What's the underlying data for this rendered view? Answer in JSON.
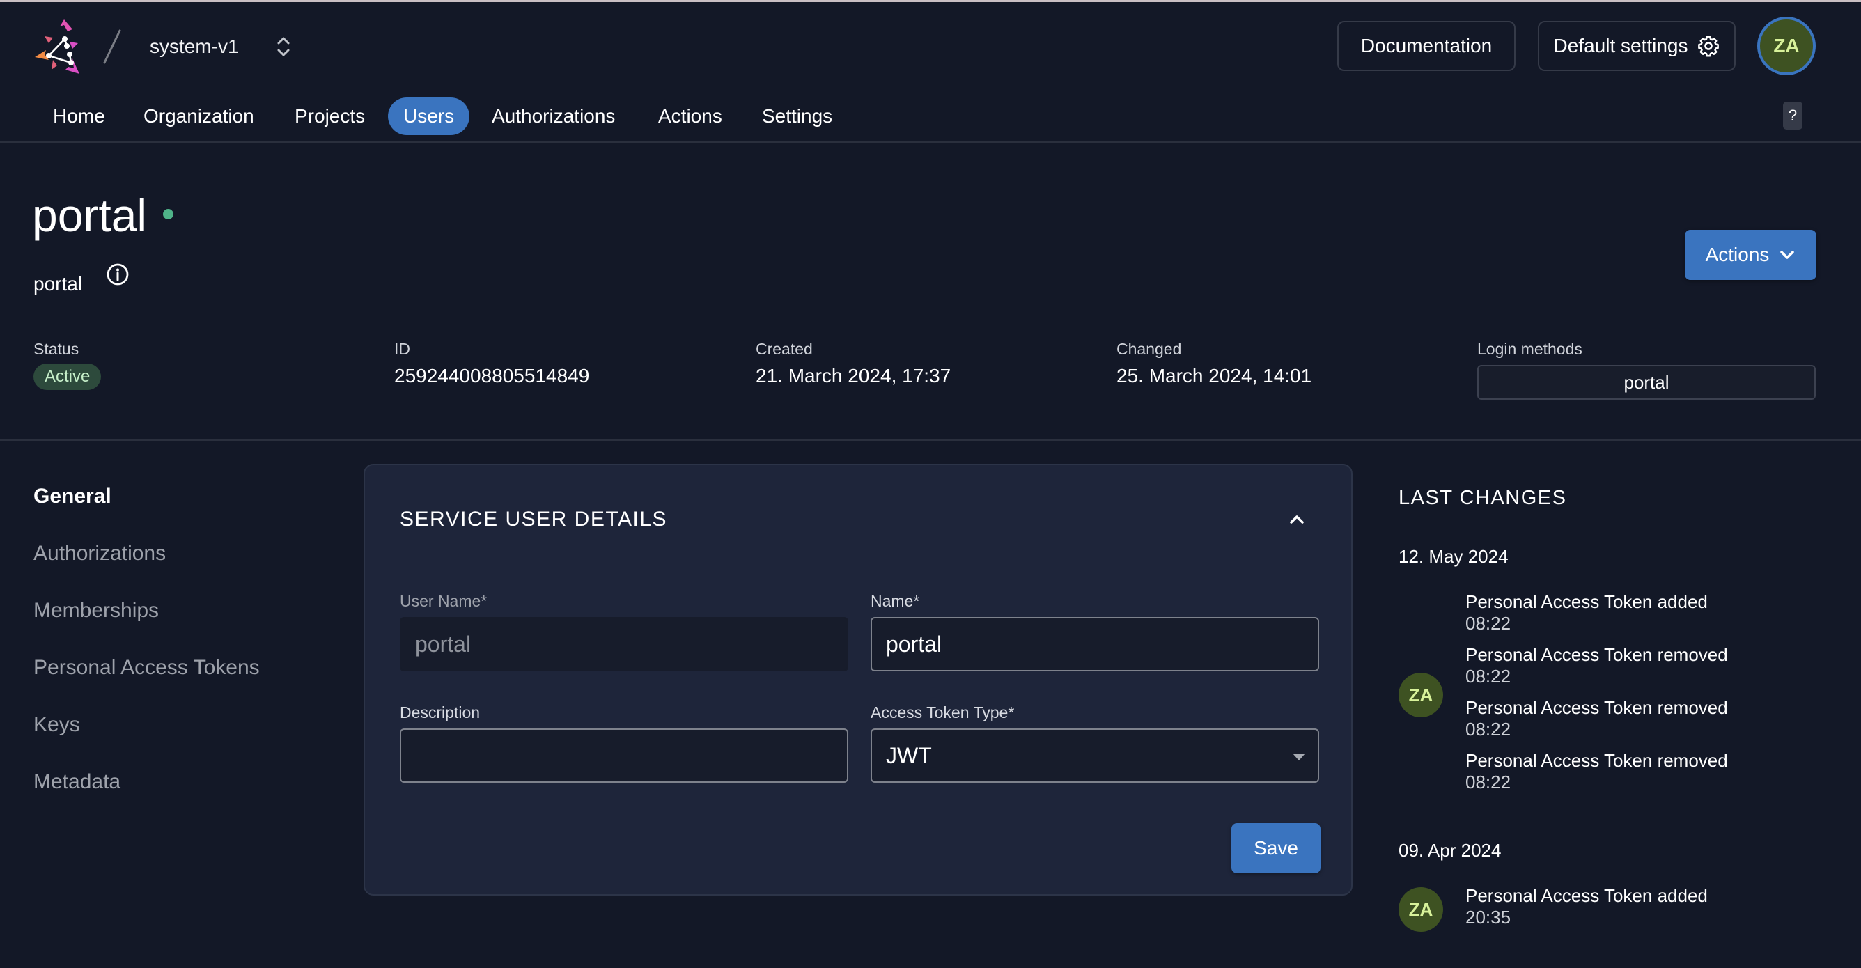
{
  "header": {
    "org_name": "system-v1",
    "documentation_label": "Documentation",
    "default_settings_label": "Default settings",
    "user_initials": "ZA",
    "help_label": "?"
  },
  "nav": {
    "tabs": [
      {
        "label": "Home",
        "active": false
      },
      {
        "label": "Organization",
        "active": false
      },
      {
        "label": "Projects",
        "active": false
      },
      {
        "label": "Users",
        "active": true
      },
      {
        "label": "Authorizations",
        "active": false
      },
      {
        "label": "Actions",
        "active": false
      },
      {
        "label": "Settings",
        "active": false
      }
    ]
  },
  "user": {
    "title": "portal",
    "subtitle": "portal",
    "actions_label": "Actions",
    "status_color": "#4fb389"
  },
  "meta": {
    "status_label": "Status",
    "status_value": "Active",
    "id_label": "ID",
    "id_value": "259244008805514849",
    "created_label": "Created",
    "created_value": "21. March 2024, 17:37",
    "changed_label": "Changed",
    "changed_value": "25. March 2024, 14:01",
    "login_methods_label": "Login methods",
    "login_methods_value": "portal"
  },
  "sidebar": {
    "items": [
      {
        "label": "General",
        "active": true
      },
      {
        "label": "Authorizations",
        "active": false
      },
      {
        "label": "Memberships",
        "active": false
      },
      {
        "label": "Personal Access Tokens",
        "active": false
      },
      {
        "label": "Keys",
        "active": false
      },
      {
        "label": "Metadata",
        "active": false
      }
    ]
  },
  "details": {
    "title": "SERVICE USER DETAILS",
    "username_label": "User Name*",
    "username_value": "portal",
    "name_label": "Name*",
    "name_value": "portal",
    "description_label": "Description",
    "description_value": "",
    "token_type_label": "Access Token Type*",
    "token_type_value": "JWT",
    "save_label": "Save"
  },
  "last_changes": {
    "title": "LAST CHANGES",
    "groups": [
      {
        "date": "12. May 2024",
        "initials": "ZA",
        "entries": [
          {
            "text": "Personal Access Token added",
            "time": "08:22"
          },
          {
            "text": "Personal Access Token removed",
            "time": "08:22"
          },
          {
            "text": "Personal Access Token removed",
            "time": "08:22"
          },
          {
            "text": "Personal Access Token removed",
            "time": "08:22"
          }
        ]
      },
      {
        "date": "09. Apr 2024",
        "initials": "ZA",
        "entries": [
          {
            "text": "Personal Access Token added",
            "time": "20:35"
          }
        ]
      }
    ]
  },
  "colors": {
    "background": "#131827",
    "accent": "#3a74bf",
    "card": "#1e253a",
    "avatar_bg": "#3e5222",
    "avatar_text": "#d8f29a"
  }
}
